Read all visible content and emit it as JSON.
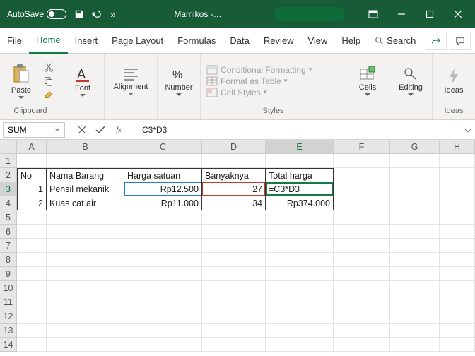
{
  "titlebar": {
    "autosave_label": "AutoSave",
    "title": "Mamikos  -…"
  },
  "tabs": {
    "file": "File",
    "home": "Home",
    "insert": "Insert",
    "page_layout": "Page Layout",
    "formulas": "Formulas",
    "data": "Data",
    "review": "Review",
    "view": "View",
    "help": "Help",
    "search": "Search"
  },
  "ribbon": {
    "clipboard": {
      "paste": "Paste",
      "label": "Clipboard"
    },
    "font": {
      "btn": "Font"
    },
    "alignment": {
      "btn": "Alignment"
    },
    "number": {
      "btn": "Number"
    },
    "styles": {
      "cond": "Conditional Formatting",
      "table": "Format as Table",
      "cell": "Cell Styles",
      "label": "Styles"
    },
    "cells": {
      "btn": "Cells"
    },
    "editing": {
      "btn": "Editing"
    },
    "ideas": {
      "btn": "Ideas",
      "label": "Ideas"
    }
  },
  "formula_bar": {
    "name": "SUM",
    "formula": "=C3*D3"
  },
  "columns": [
    "A",
    "B",
    "C",
    "D",
    "E",
    "F",
    "G",
    "H"
  ],
  "rows": [
    "1",
    "2",
    "3",
    "4",
    "5",
    "6",
    "7",
    "8",
    "9",
    "10",
    "11",
    "12",
    "13",
    "14"
  ],
  "table": {
    "headers": {
      "no": "No",
      "nama": "Nama Barang",
      "harga": "Harga  satuan",
      "banyak": "Banyaknya",
      "total": "Total harga"
    },
    "r1": {
      "no": "1",
      "nama": "Pensil mekanik",
      "harga": "Rp12.500",
      "banyak": "27",
      "total": "=C3*D3"
    },
    "r2": {
      "no": "2",
      "nama": "Kuas cat air",
      "harga": "Rp11.000",
      "banyak": "34",
      "total": "Rp374.000"
    }
  }
}
